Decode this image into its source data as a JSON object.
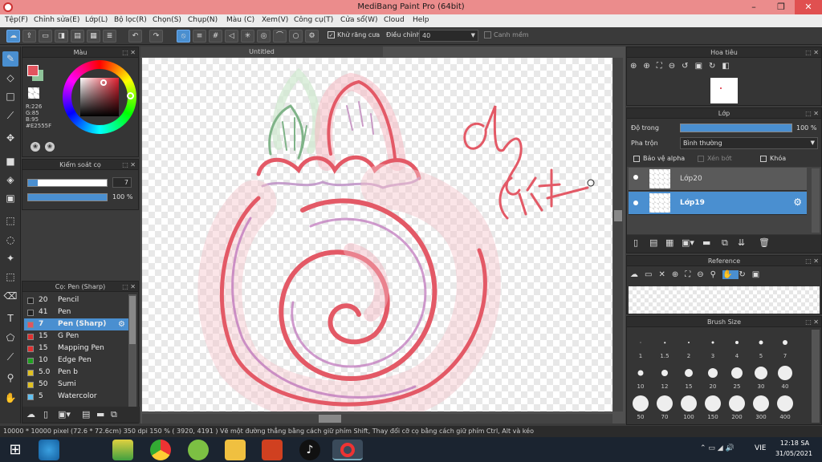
{
  "app": {
    "title": "MediBang Paint Pro (64bit)"
  },
  "menu": [
    "Tệp(F)",
    "Chỉnh sửa(E)",
    "Lớp(L)",
    "Bộ lọc(R)",
    "Chọn(S)",
    "Chụp(N)",
    "Màu (C)",
    "Xem(V)",
    "Công cụ(T)",
    "Cửa sổ(W)",
    "Cloud",
    "Help"
  ],
  "toolbar": {
    "antialias_label": "Khử răng cưa",
    "adjust_label": "Điều chỉnh",
    "adjust_value": "40",
    "snap_label": "Canh mềm"
  },
  "color_panel": {
    "title": "Màu",
    "r": "R:226",
    "g": "G:85",
    "b": "B:95",
    "hex": "#E2555F",
    "primary": "#E2555F",
    "secondary": "#8fc49a"
  },
  "brush_control": {
    "title": "Kiểm soát cọ",
    "size": "7",
    "opacity": "100 %"
  },
  "brush_panel": {
    "title": "Cọ: Pen (Sharp)",
    "items": [
      {
        "num": "20",
        "name": "Pencil",
        "color": "#222222"
      },
      {
        "num": "41",
        "name": "Pen",
        "color": "#222222"
      },
      {
        "num": "7",
        "name": "Pen (Sharp)",
        "color": "#e2555f",
        "selected": true
      },
      {
        "num": "15",
        "name": "G Pen",
        "color": "#e03030"
      },
      {
        "num": "15",
        "name": "Mapping Pen",
        "color": "#e03030"
      },
      {
        "num": "10",
        "name": "Edge Pen",
        "color": "#20a020"
      },
      {
        "num": "5.0",
        "name": "Pen b",
        "color": "#e0c020"
      },
      {
        "num": "50",
        "name": "Sumi",
        "color": "#e0c020"
      },
      {
        "num": "5",
        "name": "Watercolor",
        "color": "#60c0f0"
      }
    ]
  },
  "canvas": {
    "tab": "Untitled",
    "handwriting": "đạ rkt"
  },
  "navigator": {
    "title": "Hoa tiêu"
  },
  "layer_panel": {
    "title": "Lớp",
    "opacity_label": "Độ trong",
    "opacity_value": "100 %",
    "blend_label": "Pha trộn",
    "blend_value": "Bình thường",
    "protect_alpha": "Bảo vệ alpha",
    "clipping": "Xén bớt",
    "lock": "Khóa",
    "layers": [
      {
        "name": "Lớp20",
        "selected": false
      },
      {
        "name": "Lớp19",
        "selected": true
      }
    ]
  },
  "reference": {
    "title": "Reference"
  },
  "brush_size": {
    "title": "Brush Size",
    "sizes": [
      "1",
      "1.5",
      "2",
      "3",
      "4",
      "5",
      "7",
      "10",
      "12",
      "15",
      "20",
      "25",
      "30",
      "40",
      "50",
      "70",
      "100",
      "150",
      "200",
      "300",
      "400"
    ]
  },
  "status": {
    "text": "10000 * 10000 pixel   (72.6 * 72.6cm)   350 dpi   150 %   ( 3920, 4191 )   Vẽ một đường thẳng bằng cách giữ phím Shift, Thay đổi cỡ cọ bằng cách giữ phím Ctrl, Alt và kéo"
  },
  "taskbar": {
    "lang": "VIE",
    "time": "12:18 SA",
    "date": "31/05/2021"
  }
}
